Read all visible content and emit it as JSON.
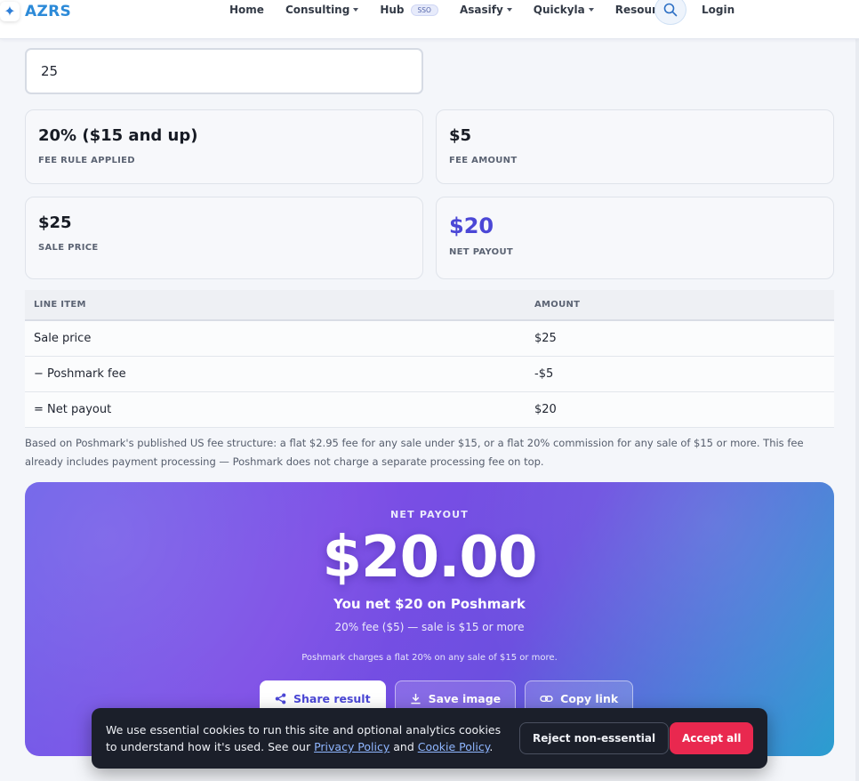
{
  "brand": {
    "name": "AZRS"
  },
  "nav": {
    "items": [
      {
        "label": "Home",
        "dropdown": false
      },
      {
        "label": "Consulting",
        "dropdown": true
      },
      {
        "label": "Hub",
        "dropdown": false,
        "badge": "SSO"
      },
      {
        "label": "Asasify",
        "dropdown": true
      },
      {
        "label": "Quickyla",
        "dropdown": true
      },
      {
        "label": "Resources",
        "dropdown": true
      }
    ],
    "login_label": "Login"
  },
  "form": {
    "sale_price_value": "25"
  },
  "stats": {
    "fee_rule": {
      "value": "20% ($15 and up)",
      "label": "FEE RULE APPLIED"
    },
    "fee_amount": {
      "value": "$5",
      "label": "FEE AMOUNT"
    },
    "sale_price": {
      "value": "$25",
      "label": "SALE PRICE"
    },
    "net_payout": {
      "value": "$20",
      "label": "NET PAYOUT"
    }
  },
  "table": {
    "headers": [
      "LINE ITEM",
      "AMOUNT"
    ],
    "rows": [
      [
        "Sale price",
        "$25"
      ],
      [
        "− Poshmark fee",
        "-$5"
      ],
      [
        "= Net payout",
        "$20"
      ]
    ]
  },
  "note": "Based on Poshmark's published US fee structure: a flat $2.95 fee for any sale under $15, or a flat 20% commission for any sale of $15 or more. This fee already includes payment processing — Poshmark does not charge a separate processing fee on top.",
  "result": {
    "label": "NET PAYOUT",
    "amount": "$20.00",
    "summary": "You net $20 on Poshmark",
    "detail": "20% fee ($5) — sale is $15 or more",
    "small": "Poshmark charges a flat 20% on any sale of $15 or more.",
    "buttons": {
      "share": "Share result",
      "save": "Save image",
      "copy": "Copy link"
    }
  },
  "cookie": {
    "text_before": "We use essential cookies to run this site and optional analytics cookies to understand how it's used. See our ",
    "privacy_link": "Privacy Policy",
    "and": " and ",
    "cookie_link": "Cookie Policy",
    "end": ".",
    "reject_label": "Reject non-essential",
    "accept_label": "Accept all"
  },
  "colors": {
    "accent": "#4b47d6",
    "brand": "#2c8ad8",
    "accept": "#e9284f"
  }
}
